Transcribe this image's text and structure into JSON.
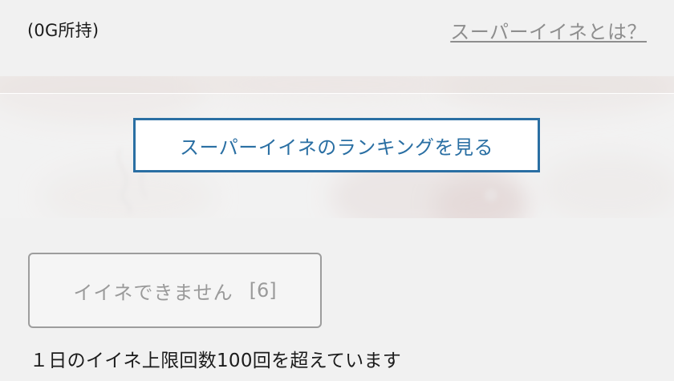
{
  "header": {
    "gold_count": "(0G所持)",
    "help_link": "スーパーイイネとは？"
  },
  "ranking": {
    "button_label": "スーパーイイネのランキングを見る"
  },
  "like": {
    "button_label": "イイネできません",
    "count": "[6]",
    "limit_message": "１日のイイネ上限回数100回を超えています"
  },
  "colors": {
    "accent": "#2a6fa3",
    "background": "#f1f1f1",
    "disabled_text": "#9a9a9a",
    "link": "#8e8e8e"
  }
}
